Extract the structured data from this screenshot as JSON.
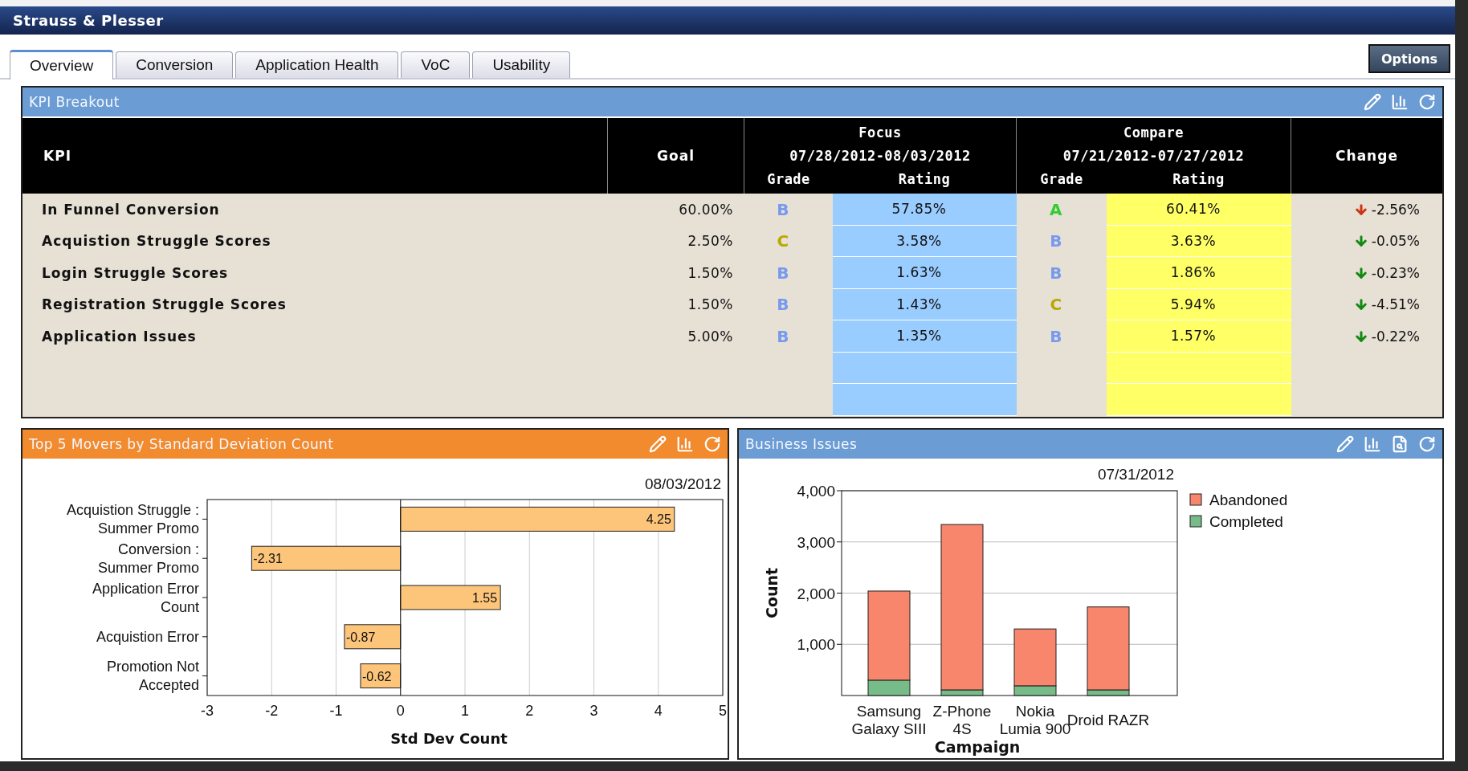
{
  "app_title": "Strauss & Plesser",
  "tabs": [
    {
      "label": "Overview",
      "selected": true
    },
    {
      "label": "Conversion",
      "selected": false
    },
    {
      "label": "Application Health",
      "selected": false
    },
    {
      "label": "VoC",
      "selected": false
    },
    {
      "label": "Usability",
      "selected": false
    }
  ],
  "options_button": "Options",
  "kpi_panel": {
    "title": "KPI Breakout",
    "columns": {
      "kpi": "KPI",
      "goal": "Goal",
      "focus": {
        "title": "Focus",
        "range": "07/28/2012-08/03/2012",
        "grade": "Grade",
        "rating": "Rating"
      },
      "compare": {
        "title": "Compare",
        "range": "07/21/2012-07/27/2012",
        "grade": "Grade",
        "rating": "Rating"
      },
      "change": "Change"
    },
    "rows": [
      {
        "kpi": "In Funnel Conversion",
        "goal": "60.00%",
        "focus_grade": {
          "text": "B",
          "color": "#7799ee"
        },
        "focus_rating": "57.85%",
        "compare_grade": {
          "text": "A",
          "color": "#33cc33"
        },
        "compare_rating": "60.41%",
        "change": {
          "text": "-2.56%",
          "color": "#cc3311"
        }
      },
      {
        "kpi": "Acquistion Struggle Scores",
        "goal": "2.50%",
        "focus_grade": {
          "text": "C",
          "color": "#b8a800"
        },
        "focus_rating": "3.58%",
        "compare_grade": {
          "text": "B",
          "color": "#7799ee"
        },
        "compare_rating": "3.63%",
        "change": {
          "text": "-0.05%",
          "color": "#118811"
        }
      },
      {
        "kpi": "Login Struggle Scores",
        "goal": "1.50%",
        "focus_grade": {
          "text": "B",
          "color": "#7799ee"
        },
        "focus_rating": "1.63%",
        "compare_grade": {
          "text": "B",
          "color": "#7799ee"
        },
        "compare_rating": "1.86%",
        "change": {
          "text": "-0.23%",
          "color": "#118811"
        }
      },
      {
        "kpi": "Registration Struggle Scores",
        "goal": "1.50%",
        "focus_grade": {
          "text": "B",
          "color": "#7799ee"
        },
        "focus_rating": "1.43%",
        "compare_grade": {
          "text": "C",
          "color": "#b8a800"
        },
        "compare_rating": "5.94%",
        "change": {
          "text": "-4.51%",
          "color": "#118811"
        }
      },
      {
        "kpi": "Application Issues",
        "goal": "5.00%",
        "focus_grade": {
          "text": "B",
          "color": "#7799ee"
        },
        "focus_rating": "1.35%",
        "compare_grade": {
          "text": "B",
          "color": "#7799ee"
        },
        "compare_rating": "1.57%",
        "change": {
          "text": "-0.22%",
          "color": "#118811"
        }
      }
    ]
  },
  "movers_panel": {
    "title": "Top 5 Movers by Standard Deviation Count",
    "chart_data": {
      "type": "bar",
      "orientation": "horizontal",
      "grid": true,
      "title": "08/03/2012",
      "xlabel": "Std Dev Count",
      "categories": [
        "Acquistion Struggle :\nSummer Promo",
        "Conversion :\nSummer Promo",
        "Application Error\nCount",
        "Acquistion Error",
        "Promotion Not\nAccepted"
      ],
      "series": [
        {
          "color": "#fcc57a",
          "values": [
            4.25,
            -2.31,
            1.55,
            -0.87,
            -0.62
          ]
        }
      ],
      "value_labels": [
        "4.25",
        "-2.31",
        "1.55",
        "-0.87",
        "-0.62"
      ],
      "xlim": [
        -3,
        5
      ],
      "xticks": [
        -3,
        -2,
        -1,
        0,
        1,
        2,
        3,
        4,
        5
      ]
    }
  },
  "issues_panel": {
    "title": "Business Issues",
    "chart_data": {
      "type": "bar",
      "stacked": true,
      "grid": true,
      "legend": "right",
      "title": "07/31/2012",
      "xlabel": "Campaign",
      "ylabel": "Count",
      "categories": [
        "Samsung\nGalaxy SIII",
        "Z-Phone\n4S",
        "Nokia\nLumia 900",
        "Droid RAZR"
      ],
      "series": [
        {
          "name": "Abandoned",
          "color": "#f8866c",
          "values": [
            1740,
            3230,
            1110,
            1620
          ]
        },
        {
          "name": "Completed",
          "color": "#77bb88",
          "values": [
            300,
            110,
            190,
            110
          ]
        }
      ],
      "ylim": [
        0,
        4000
      ],
      "yticks": [
        {
          "value": 1000,
          "label": "1,000"
        },
        {
          "value": 2000,
          "label": "2,000"
        },
        {
          "value": 3000,
          "label": "3,000"
        },
        {
          "value": 4000,
          "label": "4,000"
        }
      ]
    }
  }
}
